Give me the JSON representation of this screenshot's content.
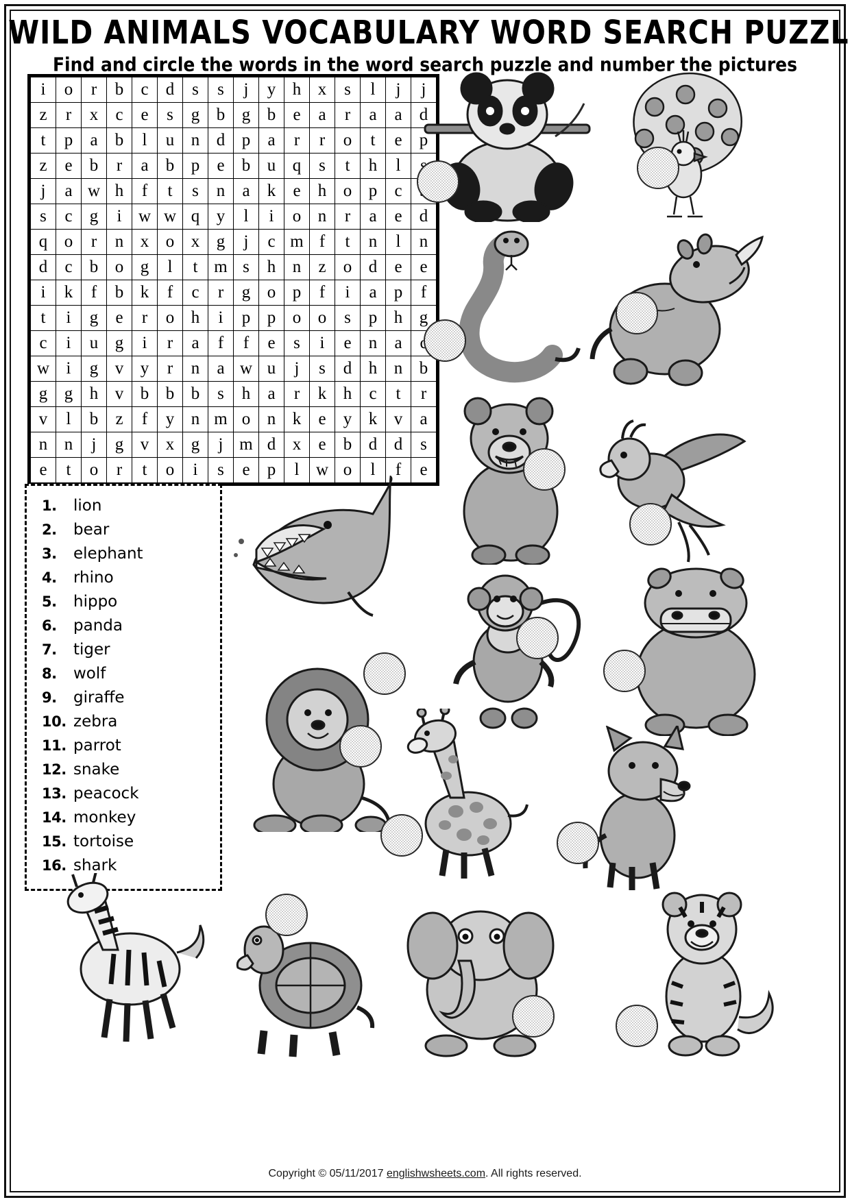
{
  "header": {
    "title": "WILD ANIMALS VOCABULARY WORD SEARCH PUZZLE I",
    "subtitle": "Find and circle the words in the word search puzzle and number the pictures"
  },
  "puzzle": {
    "rows": 16,
    "cols": 16,
    "grid": [
      [
        "i",
        "o",
        "r",
        "b",
        "c",
        "d",
        "s",
        "s",
        "j",
        "y",
        "h",
        "x",
        "s",
        "l",
        "j",
        "j"
      ],
      [
        "z",
        "r",
        "x",
        "c",
        "e",
        "s",
        "g",
        "b",
        "g",
        "b",
        "e",
        "a",
        "r",
        "a",
        "a",
        "d"
      ],
      [
        "t",
        "p",
        "a",
        "b",
        "l",
        "u",
        "n",
        "d",
        "p",
        "a",
        "r",
        "r",
        "o",
        "t",
        "e",
        "p"
      ],
      [
        "z",
        "e",
        "b",
        "r",
        "a",
        "b",
        "p",
        "e",
        "b",
        "u",
        "q",
        "s",
        "t",
        "h",
        "l",
        "s"
      ],
      [
        "j",
        "a",
        "w",
        "h",
        "f",
        "t",
        "s",
        "n",
        "a",
        "k",
        "e",
        "h",
        "o",
        "p",
        "c",
        "b"
      ],
      [
        "s",
        "c",
        "g",
        "i",
        "w",
        "w",
        "q",
        "y",
        "l",
        "i",
        "o",
        "n",
        "r",
        "a",
        "e",
        "d"
      ],
      [
        "q",
        "o",
        "r",
        "n",
        "x",
        "o",
        "x",
        "g",
        "j",
        "c",
        "m",
        "f",
        "t",
        "n",
        "l",
        "n"
      ],
      [
        "d",
        "c",
        "b",
        "o",
        "g",
        "l",
        "t",
        "m",
        "s",
        "h",
        "n",
        "z",
        "o",
        "d",
        "e",
        "e"
      ],
      [
        "i",
        "k",
        "f",
        "b",
        "k",
        "f",
        "c",
        "r",
        "g",
        "o",
        "p",
        "f",
        "i",
        "a",
        "p",
        "f"
      ],
      [
        "t",
        "i",
        "g",
        "e",
        "r",
        "o",
        "h",
        "i",
        "p",
        "p",
        "o",
        "o",
        "s",
        "p",
        "h",
        "g"
      ],
      [
        "c",
        "i",
        "u",
        "g",
        "i",
        "r",
        "a",
        "f",
        "f",
        "e",
        "s",
        "i",
        "e",
        "n",
        "a",
        "c"
      ],
      [
        "w",
        "i",
        "g",
        "v",
        "y",
        "r",
        "n",
        "a",
        "w",
        "u",
        "j",
        "s",
        "d",
        "h",
        "n",
        "b"
      ],
      [
        "g",
        "g",
        "h",
        "v",
        "b",
        "b",
        "b",
        "s",
        "h",
        "a",
        "r",
        "k",
        "h",
        "c",
        "t",
        "r"
      ],
      [
        "v",
        "l",
        "b",
        "z",
        "f",
        "y",
        "n",
        "m",
        "o",
        "n",
        "k",
        "e",
        "y",
        "k",
        "v",
        "a"
      ],
      [
        "n",
        "n",
        "j",
        "g",
        "v",
        "x",
        "g",
        "j",
        "m",
        "d",
        "x",
        "e",
        "b",
        "d",
        "d",
        "s"
      ],
      [
        "e",
        "t",
        "o",
        "r",
        "t",
        "o",
        "i",
        "s",
        "e",
        "p",
        "l",
        "w",
        "o",
        "l",
        "f",
        "e"
      ]
    ]
  },
  "wordlist": [
    {
      "num": "1.",
      "word": "lion"
    },
    {
      "num": "2.",
      "word": "bear"
    },
    {
      "num": "3.",
      "word": "elephant"
    },
    {
      "num": "4.",
      "word": "rhino"
    },
    {
      "num": "5.",
      "word": "hippo"
    },
    {
      "num": "6.",
      "word": "panda"
    },
    {
      "num": "7.",
      "word": "tiger"
    },
    {
      "num": "8.",
      "word": "wolf"
    },
    {
      "num": "9.",
      "word": "giraffe"
    },
    {
      "num": "10.",
      "word": "zebra"
    },
    {
      "num": "11.",
      "word": "parrot"
    },
    {
      "num": "12.",
      "word": "snake"
    },
    {
      "num": "13.",
      "word": "peacock"
    },
    {
      "num": "14.",
      "word": "monkey"
    },
    {
      "num": "15.",
      "word": "tortoise"
    },
    {
      "num": "16.",
      "word": "shark"
    }
  ],
  "pictures": [
    {
      "name": "panda",
      "label": ""
    },
    {
      "name": "peacock",
      "label": ""
    },
    {
      "name": "snake",
      "label": ""
    },
    {
      "name": "rhino",
      "label": ""
    },
    {
      "name": "bear",
      "label": ""
    },
    {
      "name": "parrot",
      "label": ""
    },
    {
      "name": "shark",
      "label": ""
    },
    {
      "name": "monkey",
      "label": ""
    },
    {
      "name": "hippo",
      "label": ""
    },
    {
      "name": "lion",
      "label": ""
    },
    {
      "name": "giraffe",
      "label": ""
    },
    {
      "name": "wolf",
      "label": ""
    },
    {
      "name": "zebra",
      "label": ""
    },
    {
      "name": "tortoise",
      "label": ""
    },
    {
      "name": "elephant",
      "label": ""
    },
    {
      "name": "tiger",
      "label": ""
    }
  ],
  "footer": {
    "copyright_pre": "Copyright © 05/11/2017 ",
    "site": "englishwsheets.com",
    "copyright_post": ". All rights reserved."
  },
  "colors": {
    "ink": "#000000",
    "paper": "#ffffff",
    "art_fill": "#9a9a9a",
    "art_light": "#d6d6d6"
  }
}
